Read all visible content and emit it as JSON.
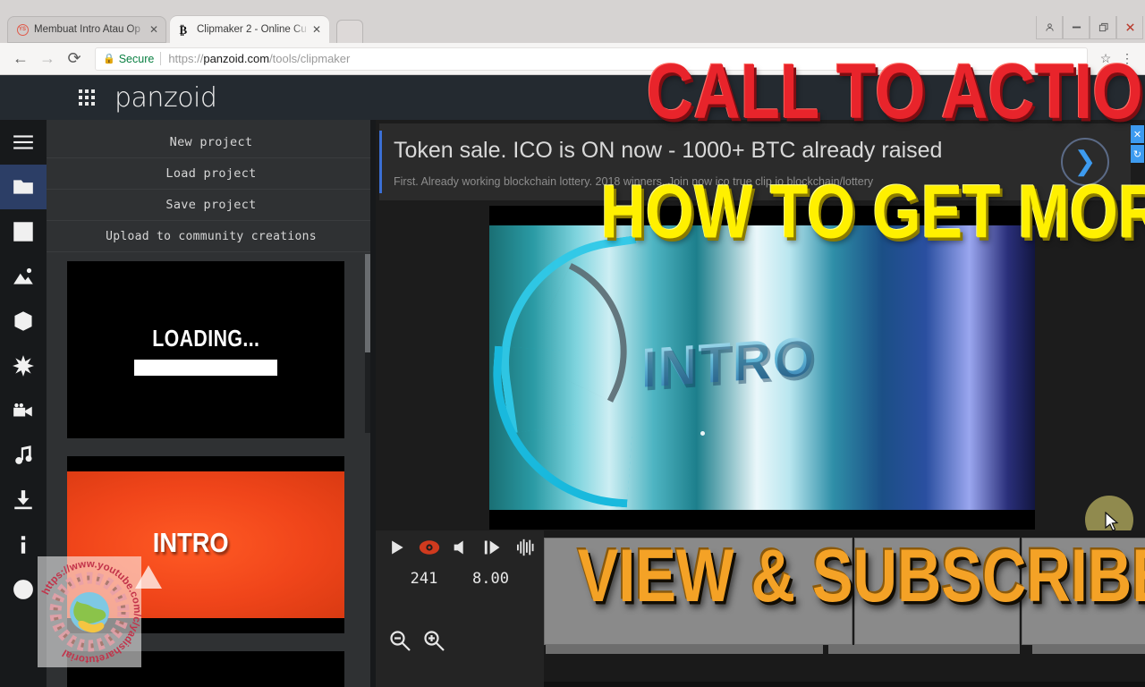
{
  "browser": {
    "tabs": [
      {
        "title": "Membuat Intro Atau Op",
        "favicon": "youtube-icon",
        "active": false,
        "close": "✕"
      },
      {
        "title": "Clipmaker 2 - Online Cu",
        "favicon": "panzoid-icon",
        "active": true,
        "close": "✕"
      }
    ],
    "new_tab_label": "",
    "window_controls": [
      {
        "name": "profile-icon",
        "glyph": "☰"
      },
      {
        "name": "minimize-icon",
        "glyph": "—"
      },
      {
        "name": "maximize-icon",
        "glyph": "❐"
      },
      {
        "name": "close-icon",
        "glyph": "✕"
      }
    ],
    "nav": {
      "back": "←",
      "forward": "→",
      "reload": "⟳"
    },
    "security_label": "Secure",
    "url_scheme": "https://",
    "url_host": "panzoid.com",
    "url_path": "/tools/clipmaker",
    "bookmark_icon": "☆",
    "menu_icon": "⋮"
  },
  "app": {
    "brand": "panzoid",
    "apps_grid_icon": "grid-icon",
    "rail": [
      {
        "name": "menu-icon",
        "label": "Menu",
        "selected": false
      },
      {
        "name": "folder-icon",
        "label": "Projects",
        "selected": true
      },
      {
        "name": "checkbox-icon",
        "label": "Presets",
        "selected": false
      },
      {
        "name": "image-icon",
        "label": "Images",
        "selected": false
      },
      {
        "name": "cube-icon",
        "label": "3D Models",
        "selected": false
      },
      {
        "name": "star-burst-icon",
        "label": "Effects",
        "selected": false
      },
      {
        "name": "camera-icon",
        "label": "Camera",
        "selected": false
      },
      {
        "name": "music-note-icon",
        "label": "Audio",
        "selected": false
      },
      {
        "name": "download-icon",
        "label": "Download",
        "selected": false
      },
      {
        "name": "info-icon",
        "label": "Info",
        "selected": false
      },
      {
        "name": "smiley-icon",
        "label": "Feedback",
        "selected": false
      }
    ],
    "menu": [
      "New project",
      "Load project",
      "Save project",
      "Upload to community creations"
    ],
    "thumbnails": [
      {
        "kind": "loading",
        "label": "LOADING..."
      },
      {
        "kind": "orange",
        "label": "INTRO"
      }
    ]
  },
  "ad": {
    "title": "Token sale. ICO is ON now - 1000+ BTC already raised",
    "subtitle": "First. Already working blockchain lottery. 2018 winners. Join now ico true clip io blockchain/lottery",
    "next_icon": "❯",
    "side_buttons": [
      "✕",
      "↻"
    ]
  },
  "preview": {
    "text": "INTRO"
  },
  "transport": {
    "buttons": [
      {
        "name": "play-button",
        "glyph": "play"
      },
      {
        "name": "visibility-button",
        "glyph": "eye",
        "color": "#d03a1e"
      },
      {
        "name": "mute-button",
        "glyph": "speaker"
      },
      {
        "name": "step-frame-button",
        "glyph": "step"
      },
      {
        "name": "waveform-button",
        "glyph": "wave"
      }
    ],
    "frame_value": "241",
    "time_value": "8.00",
    "zoom_out_icon": "zoom-out-icon",
    "zoom_in_icon": "zoom-in-icon"
  },
  "overlays": {
    "line1": "CALL TO ACTION",
    "line1_color": "#e8242b",
    "line2": "HOW TO GET MORE",
    "line2_color": "#fff000",
    "line3": "VIEW & SUBSCRIBER",
    "line3_color": "#f4a226"
  },
  "watermark": {
    "text_top": "https://www.youtube.com/c/yadisharetutorial"
  }
}
